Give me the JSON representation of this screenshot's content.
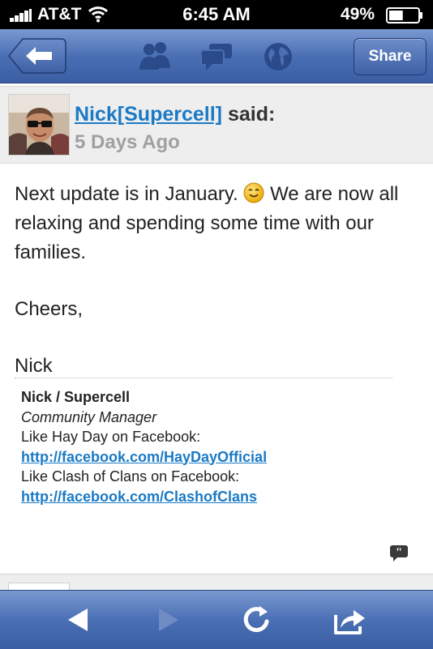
{
  "status_bar": {
    "carrier": "AT&T",
    "time": "6:45 AM",
    "battery": "49%",
    "battery_level": 0.49
  },
  "nav_bar": {
    "share_label": "Share",
    "icons": [
      "back-arrow-icon",
      "friends-icon",
      "messages-icon",
      "globe-icon"
    ]
  },
  "post": {
    "author": "Nick[Supercell]",
    "said": "said:",
    "date": "5 Days Ago",
    "body": {
      "line1_a": "Next update is in January.",
      "line1_b": "We are now all relaxing and spending some time with our families.",
      "cheers": "Cheers,",
      "sign": "Nick"
    },
    "signature": {
      "name": "Nick / Supercell",
      "role": "Community Manager",
      "hayday_text": "Like Hay Day on Facebook:",
      "hayday_link": "http://facebook.com/HayDayOfficial",
      "coc_text": "Like Clash of Clans on Facebook:",
      "coc_link": "http://facebook.com/ClashofClans"
    }
  },
  "toolbar": {
    "icons": [
      "back-icon",
      "forward-icon",
      "reload-icon",
      "share-out-icon"
    ]
  },
  "colors": {
    "nav_blue": "#3b5ea3",
    "link_blue": "#1a7ac6",
    "date_grey": "#a0a0a0"
  }
}
